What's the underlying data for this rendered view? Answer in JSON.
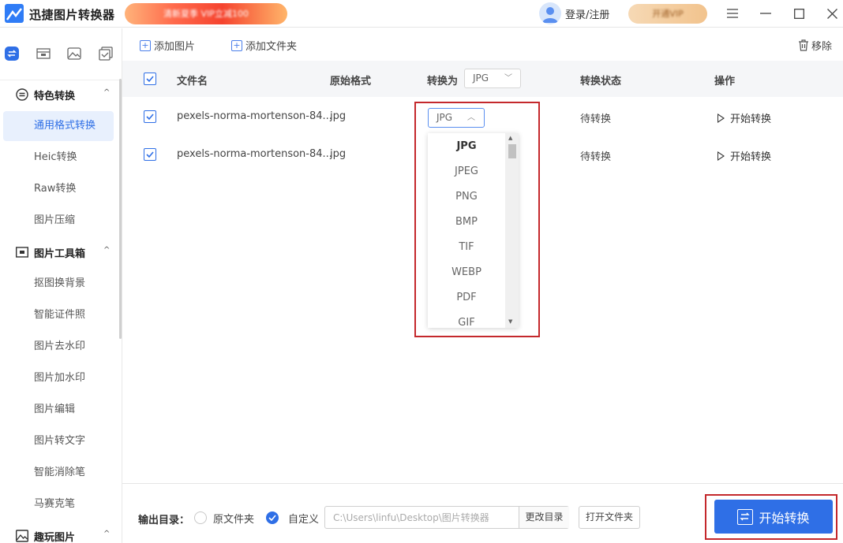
{
  "app": {
    "title": "迅捷图片转换器",
    "vip_banner": "清新夏季 VIP立减100",
    "login_label": "登录/注册",
    "vip_open_label": "开通VIP"
  },
  "window_controls": {
    "menu": "☰",
    "minimize": "—",
    "maximize": "☐",
    "close": "✕"
  },
  "sidebar": {
    "top_icons": [
      "convert-icon",
      "toolbox-icon",
      "image-icon",
      "check-icon"
    ],
    "sections": [
      {
        "title": "特色转换",
        "icon": "convert-icon",
        "caret": "^",
        "items": [
          "通用格式转换",
          "Heic转换",
          "Raw转换",
          "图片压缩"
        ]
      },
      {
        "title": "图片工具箱",
        "icon": "toolbox-icon",
        "caret": "^",
        "items": [
          "抠图换背景",
          "智能证件照",
          "图片去水印",
          "图片加水印",
          "图片编辑",
          "图片转文字",
          "智能消除笔",
          "马赛克笔"
        ]
      },
      {
        "title": "趣玩图片",
        "icon": "image-icon",
        "caret": "^",
        "items": []
      }
    ],
    "active_item": "通用格式转换"
  },
  "toolbar": {
    "add_image": "添加图片",
    "add_folder": "添加文件夹",
    "remove": "移除"
  },
  "table": {
    "headers": {
      "name": "文件名",
      "origin": "原始格式",
      "convert_to": "转换为",
      "status": "转换状态",
      "action": "操作"
    },
    "header_format": "JPG",
    "rows": [
      {
        "name": "pexels-norma-mortenson-84...",
        "origin": "jpg",
        "format": "JPG",
        "status": "待转换",
        "action": "开始转换",
        "checked": true
      },
      {
        "name": "pexels-norma-mortenson-84...",
        "origin": "jpg",
        "format": "JPG",
        "status": "待转换",
        "action": "开始转换",
        "checked": true
      }
    ]
  },
  "dropdown": {
    "selected": "JPG",
    "options": [
      "JPG",
      "JPEG",
      "PNG",
      "BMP",
      "TIF",
      "WEBP",
      "PDF",
      "GIF"
    ]
  },
  "footer": {
    "output_label": "输出目录：",
    "option_original": "原文件夹",
    "option_custom": "自定义",
    "selected_option": "自定义",
    "path_value": "C:\\Users\\linfu\\Desktop\\图片转换器",
    "change_dir": "更改目录",
    "open_folder": "打开文件夹",
    "start_all": "开始转换"
  },
  "colors": {
    "accent": "#2f6fe6",
    "highlight_border": "#c4282c",
    "header_bg": "#f5f6f8"
  }
}
